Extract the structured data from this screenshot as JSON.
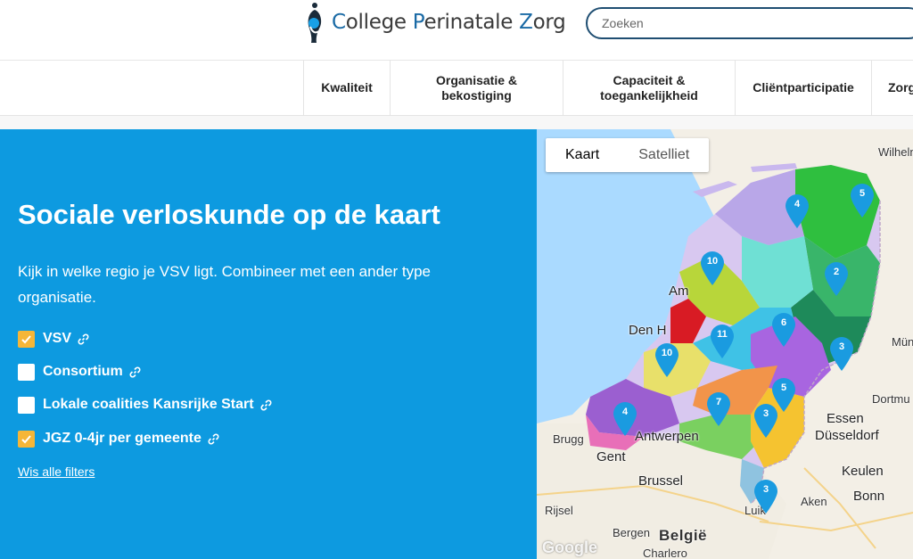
{
  "header": {
    "logo_text_parts": [
      "C",
      "ollege ",
      "P",
      "erinatale ",
      "Z",
      "org"
    ],
    "search_placeholder": "Zoeken"
  },
  "nav": {
    "items": [
      {
        "label": "Kwaliteit"
      },
      {
        "label": "Organisatie &\nbekostiging"
      },
      {
        "label": "Capaciteit &\ntoegankelijkheid"
      },
      {
        "label": "Cliëntparticipatie"
      },
      {
        "label": "Zorg"
      }
    ]
  },
  "panel": {
    "title": "Sociale verloskunde op de kaart",
    "intro": "Kijk in welke regio je VSV ligt. Combineer met een ander type organisatie.",
    "filters": [
      {
        "label": "VSV",
        "checked": true
      },
      {
        "label": "Consortium",
        "checked": false
      },
      {
        "label": "Lokale coalities Kansrijke Start",
        "checked": false
      },
      {
        "label": "JGZ 0-4jr per gemeente",
        "checked": true
      }
    ],
    "clear_label": "Wis alle filters"
  },
  "map": {
    "toggle": {
      "map_label": "Kaart",
      "satellite_label": "Satelliet"
    },
    "cities": [
      {
        "name": "Wilheln",
        "cls": ""
      },
      {
        "name": "Am",
        "cls": "big"
      },
      {
        "name": "Den H",
        "cls": "big"
      },
      {
        "name": "Mün",
        "cls": ""
      },
      {
        "name": "Dortmu",
        "cls": ""
      },
      {
        "name": "Essen",
        "cls": "big"
      },
      {
        "name": "Düsseldorf",
        "cls": "big"
      },
      {
        "name": "Brugg",
        "cls": ""
      },
      {
        "name": "Antwerpen",
        "cls": "big"
      },
      {
        "name": "Gent",
        "cls": "big"
      },
      {
        "name": "Keulen",
        "cls": "big"
      },
      {
        "name": "Brussel",
        "cls": "big"
      },
      {
        "name": "Bonn",
        "cls": "big"
      },
      {
        "name": "Aken",
        "cls": ""
      },
      {
        "name": "Rijsel",
        "cls": ""
      },
      {
        "name": "Luik",
        "cls": ""
      },
      {
        "name": "Bergen",
        "cls": ""
      },
      {
        "name": "België",
        "cls": "country"
      },
      {
        "name": "Charlero",
        "cls": ""
      }
    ],
    "markers": [
      "4",
      "5",
      "10",
      "2",
      "6",
      "11",
      "3",
      "10",
      "5",
      "7",
      "4",
      "3",
      "3"
    ],
    "attribution": "Google"
  },
  "colors": {
    "panel_bg": "#0d9ae0",
    "checkbox_checked": "#f5b638",
    "marker": "#1a9be0",
    "map_water": "#aadaff"
  }
}
